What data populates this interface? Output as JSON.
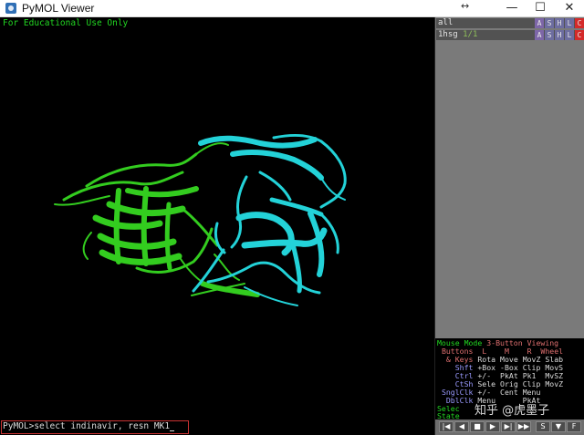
{
  "window": {
    "title": "PyMOL Viewer",
    "resize_glyph": "↔",
    "minimize": "—",
    "maximize": "☐",
    "close": "✕"
  },
  "viewport": {
    "notice": "For Educational Use Only",
    "chain_a_color": "#33cc1f",
    "chain_b_color": "#23d2d8"
  },
  "command": {
    "prompt": "PyMOL>",
    "text": "select indinavir, resn MK1"
  },
  "objects": [
    {
      "name": "all",
      "state": "",
      "buttons": [
        "A",
        "S",
        "H",
        "L",
        "C"
      ]
    },
    {
      "name": "1hsg",
      "state": "1/1",
      "buttons": [
        "A",
        "S",
        "H",
        "L",
        "C"
      ]
    }
  ],
  "object_button_colors": {
    "A": "#7d66a8",
    "S": "#6d6da0",
    "H": "#6d6da0",
    "L": "#6d6da0",
    "C": "#d42a2a"
  },
  "mouse_panel": {
    "title_left": "Mouse Mode",
    "title_right": "3-Button Viewing",
    "header": {
      "label": "Buttons",
      "l": "L",
      "m": "M",
      "r": "R",
      "wheel": "Wheel"
    },
    "rows": [
      {
        "key": "& Keys",
        "l": "Rota",
        "m": "Move",
        "r": "MovZ",
        "w": "Slab"
      },
      {
        "key": "Shft",
        "l": "+Box",
        "m": "-Box",
        "r": "Clip",
        "w": "MovS"
      },
      {
        "key": "Ctrl",
        "l": "+/-",
        "m": "PkAt",
        "r": "Pk1",
        "w": "MvSZ"
      },
      {
        "key": "CtSh",
        "l": "Sele",
        "m": "Orig",
        "r": "Clip",
        "w": "MovZ"
      },
      {
        "key": "SnglClk",
        "l": "+/-",
        "m": "Cent",
        "r": "Menu",
        "w": ""
      },
      {
        "key": "DblClk",
        "l": "Menu",
        "m": "",
        "r": "PkAt",
        "w": ""
      }
    ],
    "sele_label": "Selec",
    "state_label": "State"
  },
  "playback": [
    {
      "name": "rewind",
      "glyph": "|◀"
    },
    {
      "name": "back",
      "glyph": "◀"
    },
    {
      "name": "stop",
      "glyph": "■"
    },
    {
      "name": "play",
      "glyph": "▶"
    },
    {
      "name": "forward",
      "glyph": "▶|"
    },
    {
      "name": "end",
      "glyph": "▶▶"
    },
    {
      "name": "scene",
      "glyph": "S"
    },
    {
      "name": "seq",
      "glyph": "▼"
    },
    {
      "name": "full",
      "glyph": "F"
    }
  ],
  "watermark": "知乎 @虎墨子"
}
